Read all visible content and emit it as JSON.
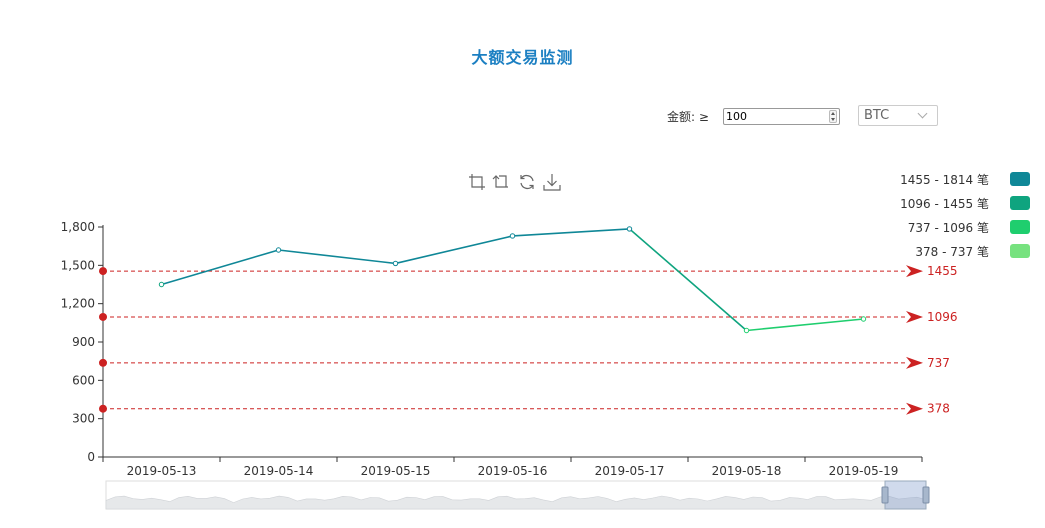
{
  "title": "大额交易监测",
  "filter": {
    "amount_label": "金额: ≥",
    "amount_value": "100",
    "coin_selected": "BTC"
  },
  "toolbox": {
    "icons": [
      "zoom-icon",
      "zoom-reset-icon",
      "restore-icon",
      "download-icon"
    ]
  },
  "legend": [
    {
      "label": "1455 - 1814 笔",
      "color": "#0f8797"
    },
    {
      "label": "1096 - 1455 笔",
      "color": "#0fa47f"
    },
    {
      "label": "737 - 1096 笔",
      "color": "#1fce6e"
    },
    {
      "label": "378 - 737 笔",
      "color": "#77e27f"
    }
  ],
  "chart_data": {
    "type": "line",
    "title": "大额交易监测",
    "categories": [
      "2019-05-13",
      "2019-05-14",
      "2019-05-15",
      "2019-05-16",
      "2019-05-17",
      "2019-05-18",
      "2019-05-19"
    ],
    "series": [
      {
        "values": [
          1350,
          1620,
          1515,
          1730,
          1785,
          990,
          1080
        ]
      }
    ],
    "y_ticks": [
      0,
      300,
      600,
      900,
      1200,
      1500,
      1800
    ],
    "y_tick_labels": [
      "0",
      "300",
      "600",
      "900",
      "1,200",
      "1,500",
      "1,800"
    ],
    "ylim": [
      0,
      1800
    ],
    "xlabel": "",
    "ylabel": "",
    "mark_lines": [
      {
        "value": 1455,
        "label": "1455"
      },
      {
        "value": 1096,
        "label": "1096"
      },
      {
        "value": 737,
        "label": "737"
      },
      {
        "value": 378,
        "label": "378"
      }
    ],
    "mark_color": "#cc2222",
    "visual_map_pieces": [
      {
        "min": 1455,
        "max": 1814,
        "color": "#0f8797"
      },
      {
        "min": 1096,
        "max": 1455,
        "color": "#0fa47f"
      },
      {
        "min": 737,
        "max": 1096,
        "color": "#1fce6e"
      },
      {
        "min": 378,
        "max": 737,
        "color": "#77e27f"
      }
    ],
    "data_zoom": {
      "start_fraction": 0.95,
      "end_fraction": 1.0
    },
    "grid": false,
    "legend_position": "top-right"
  }
}
